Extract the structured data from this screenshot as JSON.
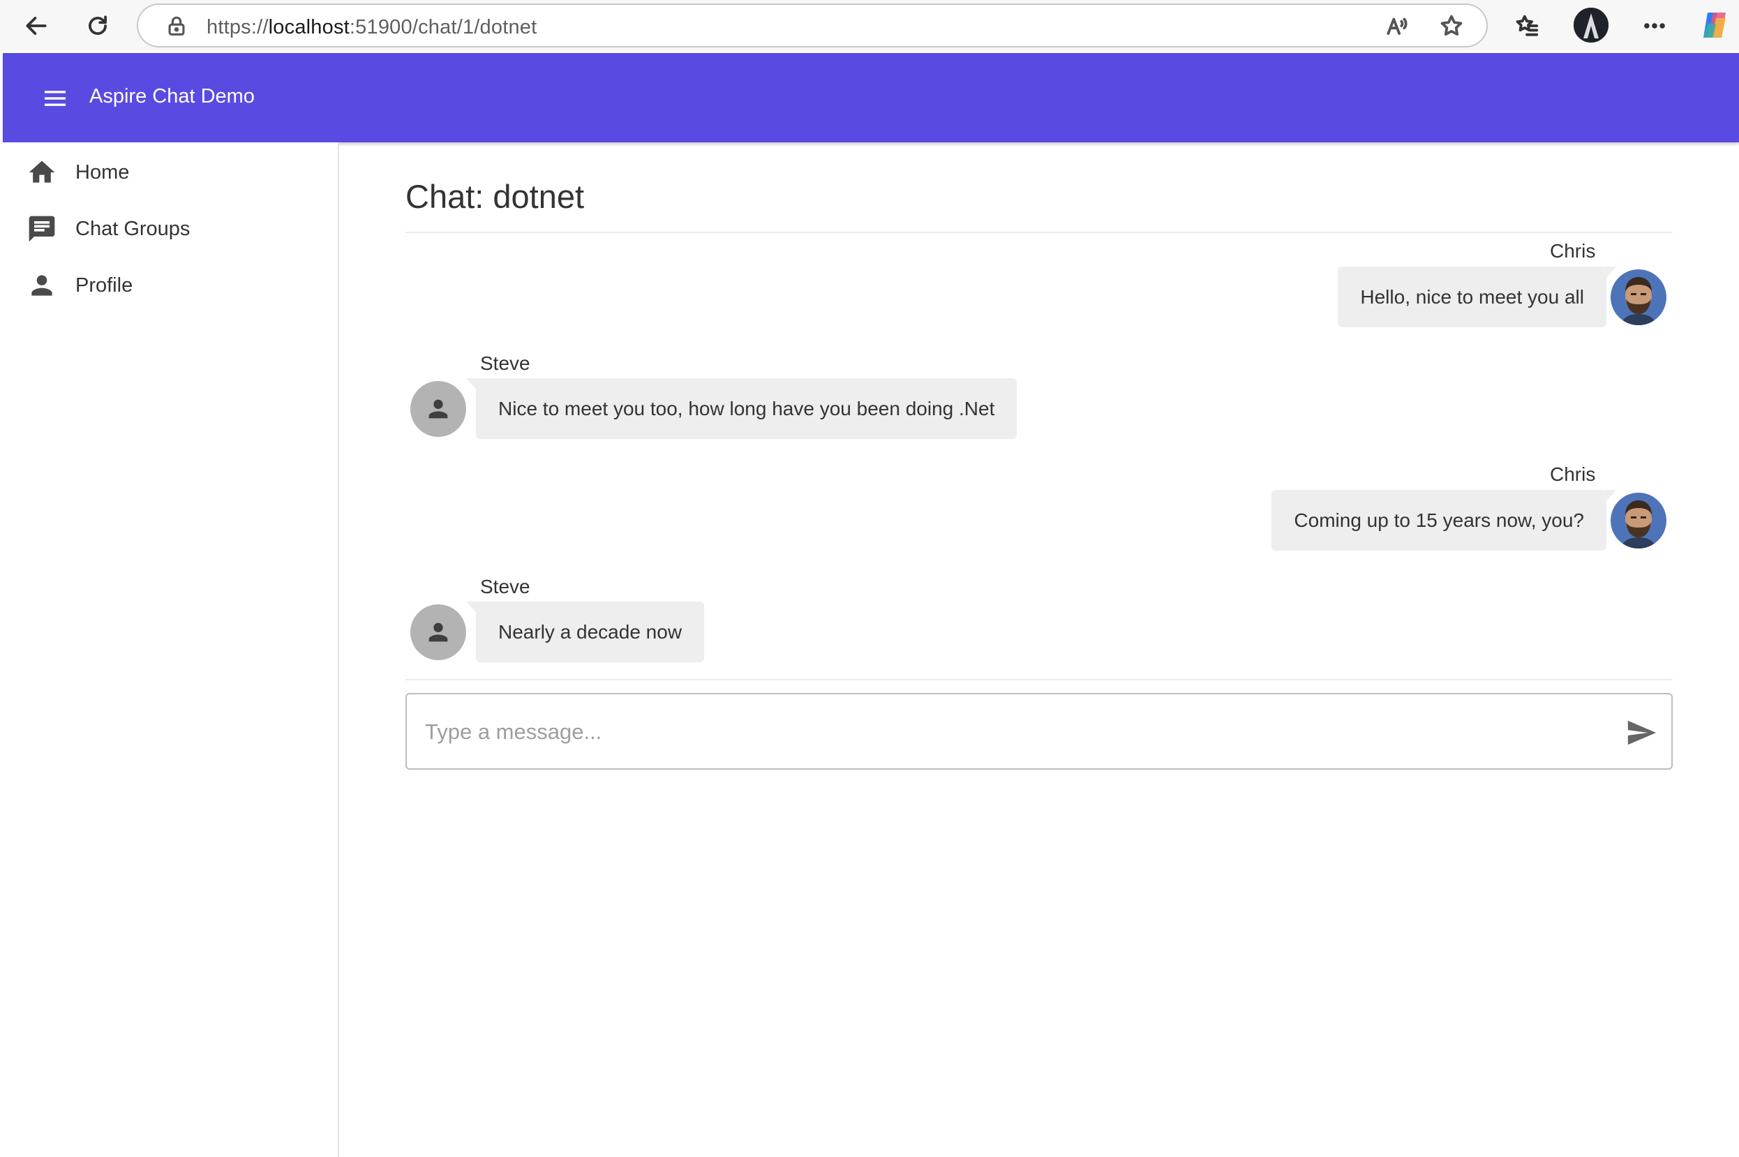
{
  "browser": {
    "url_prefix": "https://",
    "url_host": "localhost",
    "url_rest": ":51900/chat/1/dotnet"
  },
  "app": {
    "title": "Aspire Chat Demo",
    "accent_color": "#594ae2"
  },
  "nav": {
    "items": [
      {
        "label": "Home",
        "icon": "home-icon"
      },
      {
        "label": "Chat Groups",
        "icon": "chat-icon"
      },
      {
        "label": "Profile",
        "icon": "person-icon"
      }
    ]
  },
  "chat": {
    "title": "Chat: dotnet",
    "messages": [
      {
        "sender": "Chris",
        "text": "Hello, nice to meet you all",
        "side": "right"
      },
      {
        "sender": "Steve",
        "text": "Nice to meet you too, how long have you been doing .Net",
        "side": "left"
      },
      {
        "sender": "Chris",
        "text": "Coming up to 15 years now, you?",
        "side": "right"
      },
      {
        "sender": "Steve",
        "text": "Nearly a decade now",
        "side": "left"
      }
    ],
    "composer_placeholder": "Type a message..."
  }
}
